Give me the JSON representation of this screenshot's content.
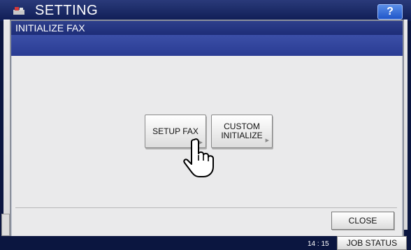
{
  "app": {
    "title": "SETTING",
    "help_label": "?"
  },
  "dialog": {
    "title": "INITIALIZE FAX",
    "buttons": [
      {
        "label": "SETUP FAX"
      },
      {
        "label_line1": "CUSTOM",
        "label_line2": "INITIALIZE"
      }
    ],
    "close_label": "CLOSE"
  },
  "status": {
    "time": "14 : 15",
    "job_status_label": "JOB STATUS"
  },
  "colors": {
    "header_blue": "#1d2d78",
    "band_blue": "#3b4fa7",
    "background": "#0b1640"
  }
}
